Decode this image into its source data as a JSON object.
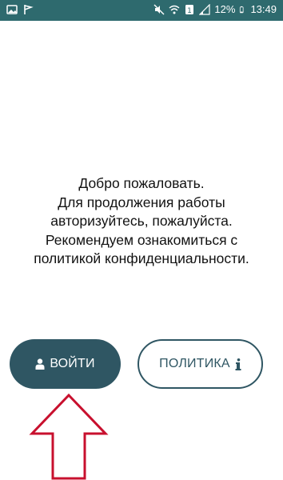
{
  "status_bar": {
    "battery_percent": "12%",
    "time": "13:49",
    "icons": [
      "image-icon",
      "flag-icon",
      "mute-icon",
      "wifi-icon",
      "sim-icon",
      "signal-icon",
      "battery-icon"
    ]
  },
  "welcome": {
    "lines": [
      "Добро пожаловать.",
      "Для продолжения работы",
      "авторизуйтесь, пожалуйста.",
      "Рекомендуем ознакомиться с",
      "политикой конфиденциальности."
    ]
  },
  "buttons": {
    "login_label": "ВОЙТИ",
    "policy_label": "ПОЛИТИКА",
    "login_icon": "user-icon",
    "policy_icon": "info-icon"
  },
  "colors": {
    "status_bar": "#2e6a6e",
    "primary": "#2f5663",
    "annotation_arrow": "#c8102e"
  }
}
